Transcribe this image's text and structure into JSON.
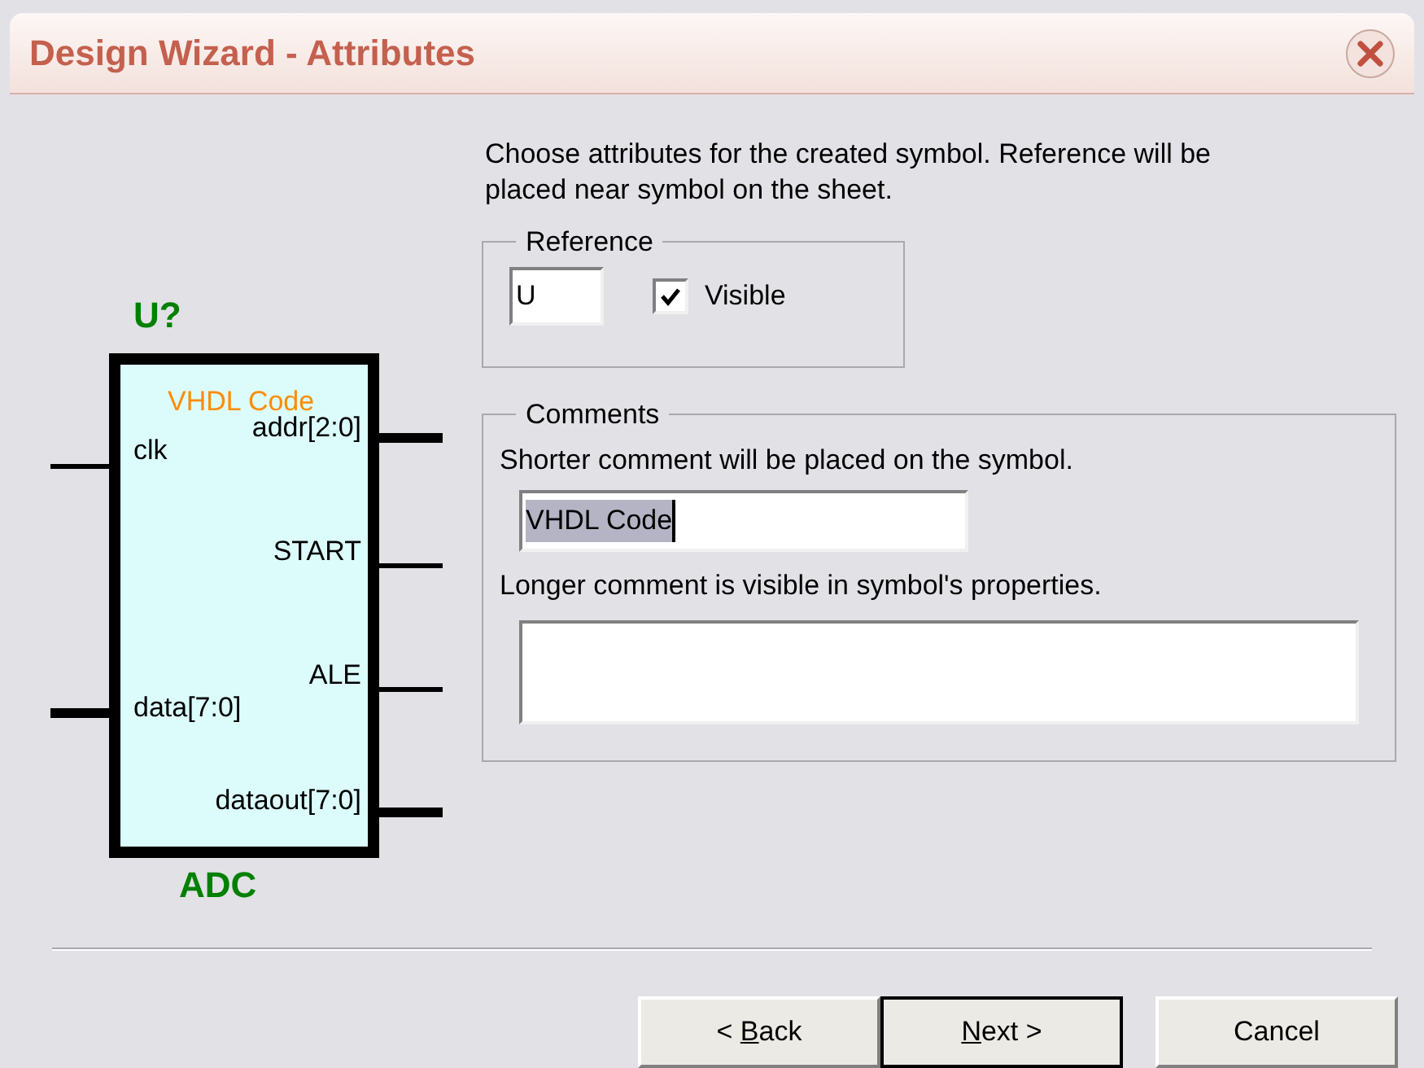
{
  "window": {
    "title": "Design Wizard - Attributes"
  },
  "symbol": {
    "reference": "U?",
    "name": "ADC",
    "comment": "VHDL Code",
    "left_pins": [
      {
        "label": "clk",
        "bus": false
      },
      {
        "label": "data[7:0]",
        "bus": true
      }
    ],
    "right_pins": [
      {
        "label": "addr[2:0]",
        "bus": true
      },
      {
        "label": "START",
        "bus": false
      },
      {
        "label": "ALE",
        "bus": false
      },
      {
        "label": "dataout[7:0]",
        "bus": true
      }
    ]
  },
  "instructions": "Choose attributes for the created symbol. Reference will be placed near symbol on the sheet.",
  "reference_group": {
    "title": "Reference",
    "value": "U",
    "visible_label": "Visible",
    "visible_checked": true
  },
  "comments_group": {
    "title": "Comments",
    "short_hint": "Shorter comment will be placed on the symbol.",
    "short_value": "VHDL Code",
    "long_hint": "Longer comment is visible in symbol's properties."
  },
  "buttons": [
    {
      "before": "< ",
      "mnemonic": "B",
      "after": "ack",
      "default": false
    },
    {
      "mnemonic": "N",
      "after": "ext >",
      "default": true
    },
    {
      "before": "Cancel",
      "default": false
    }
  ]
}
